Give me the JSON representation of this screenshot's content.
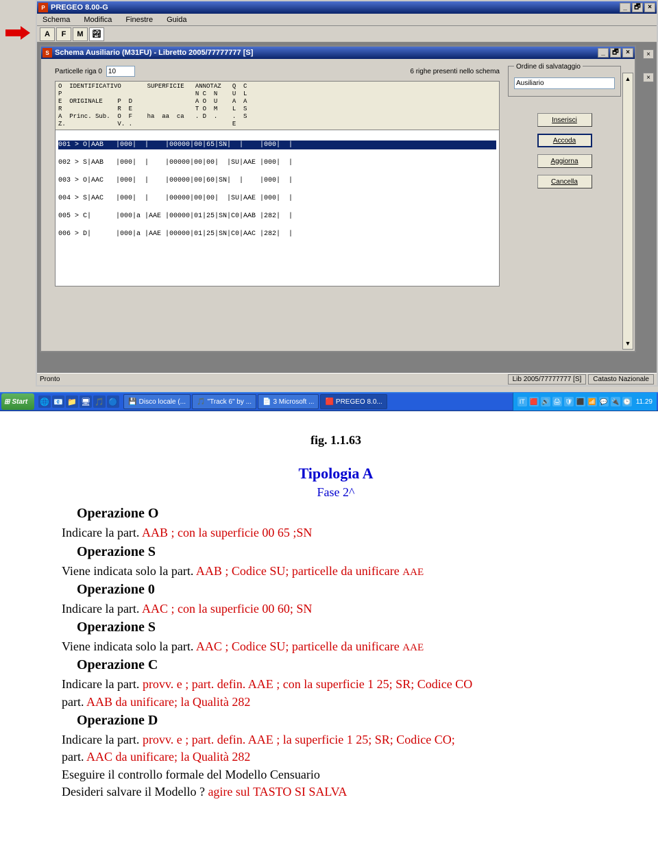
{
  "app": {
    "title": "PREGEO 8.00-G",
    "menu": [
      "Schema",
      "Modifica",
      "Finestre",
      "Guida"
    ],
    "toolbarBtns": [
      "A",
      "F",
      "M"
    ],
    "winCtrls": {
      "min": "_",
      "max": "🗗",
      "close": "×"
    }
  },
  "child": {
    "title": "Schema Ausiliario (M31FU) - Libretto 2005/77777777 [S]",
    "particelleLabel": "Particelle riga 0",
    "particelleValue": "10",
    "righeNote": "6 righe presenti nello schema",
    "ordineLabel": "Ordine di salvataggio",
    "ordineValue": "Ausiliario",
    "btns": {
      "inserisci": "Inserisci",
      "accoda": "Accoda",
      "aggiorna": "Aggiorna",
      "cancella": "Cancella"
    },
    "headerLines": "O  IDENTIFICATIVO       SUPERFICIE   ANNOTAZ   Q  C\nP                                    N C  N    U  L\nE  ORIGINALE    P  D                 A O  U    A  A\nR               R  E                 T O  M    L  S\nA  Princ. Sub.  O  F    ha  aa  ca   . D  .    .  S\nZ.              V. .                           E",
    "rows": [
      "001 > O|AAB   |000|  |    |00000|00|65|SN|  |    |000|  |",
      "002 > S|AAB   |000|  |    |00000|00|00|  |SU|AAE |000|  |",
      "003 > O|AAC   |000|  |    |00000|00|60|SN|  |    |000|  |",
      "004 > S|AAC   |000|  |    |00000|00|00|  |SU|AAE |000|  |",
      "005 > C|      |000|a |AAE |00000|01|25|SN|C0|AAB |282|  |",
      "006 > D|      |000|a |AAE |00000|01|25|SN|C0|AAC |282|  |"
    ]
  },
  "status": {
    "left": "Pronto",
    "mid": "Lib 2005/77777777 [S]",
    "right": "Catasto Nazionale"
  },
  "taskbar": {
    "start": "Start",
    "quick": [
      "🌐",
      "📧",
      "📁",
      "🖥",
      "🎵",
      "🔵"
    ],
    "tasks": [
      {
        "icon": "💾",
        "label": "Disco locale (..."
      },
      {
        "icon": "🎵",
        "label": "\"Track 6\" by ..."
      },
      {
        "icon": "📄",
        "label": "3 Microsoft ..."
      },
      {
        "icon": "🟥",
        "label": "PREGEO 8.0...",
        "active": true
      }
    ],
    "tray": [
      "IT",
      "🟥",
      "🔊",
      "🖨",
      "🛡",
      "⬛",
      "📶",
      "💬",
      "🔌",
      "🕒"
    ],
    "clock": "11.29"
  },
  "doc": {
    "fig": "fig. 1.1.63",
    "tipologia": "Tipologia A",
    "fase": "Fase 2^",
    "opO": "Operazione O",
    "opO_t1": "Indicare la part. ",
    "opO_r1": "AAB  ; con la superficie 00 65 ;SN",
    "opS1": "Operazione S",
    "opS1_t1": "Viene indicata solo  la part.",
    "opS1_r1": " AAB  ; Codice SU; particelle da unificare ",
    "opS1_r1s": "AAE",
    "op0": "Operazione 0",
    "op0_t1": "Indicare la part.",
    "op0_r1": " AAC  ; con la superficie 00 60;  SN",
    "opS2": "Operazione S",
    "opS2_t1": "Viene indicata solo  la part.",
    "opS2_r1": " AAC ; Codice SU; particelle da unificare ",
    "opS2_r1s": "AAE",
    "opC": "Operazione C",
    "opC_t1": "Indicare la part. ",
    "opC_r1a": "provv. e ; part. defin.",
    "opC_r1b": " AAE ; con la superficie 1 25;  SR; Codice CO",
    "opC_t2": "part.",
    "opC_r2": " AAB da unificare;  la Qualità 282",
    "opD": "Operazione D",
    "opD_t1": "Indicare la part. ",
    "opD_r1a": "provv. e ; part. defin.",
    "opD_r1b": " AAE ; la superficie 1 25;  SR; Codice CO;",
    "opD_t2": " part.",
    "opD_r2": " AAC da unificare; la Qualità 282",
    "foot1": "Eseguire il controllo formale del Modello Censuario",
    "foot2a": "Desideri salvare il Modello ?",
    "foot2b": " agire sul  TASTO SI   SALVA"
  }
}
